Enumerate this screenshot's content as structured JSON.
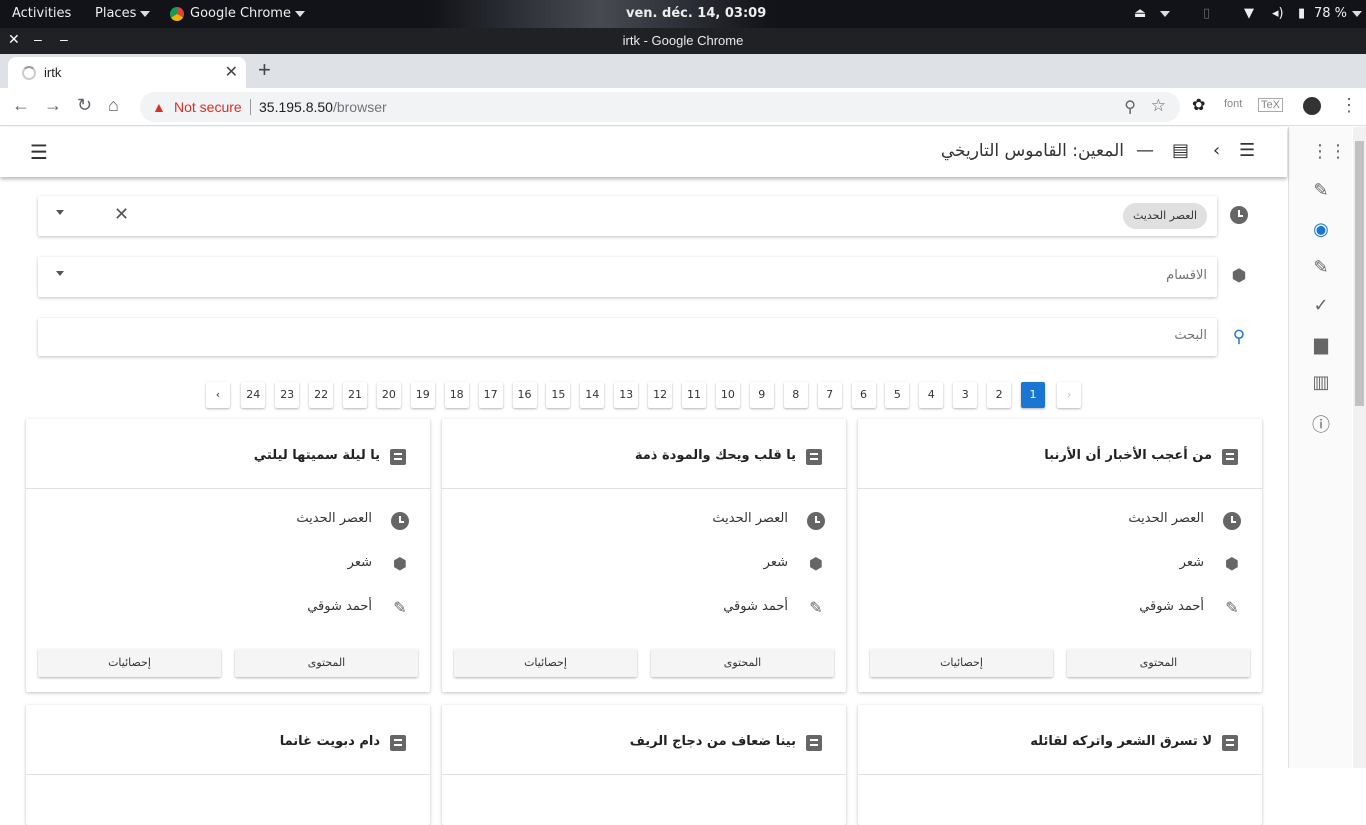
{
  "gnome": {
    "activities": "Activities",
    "places": "Places",
    "app": "Google Chrome",
    "clock": "ven. déc. 14, 03:09",
    "battery": "78 %"
  },
  "window": {
    "title": "irtk - Google Chrome"
  },
  "tab": {
    "label": "irtk"
  },
  "omnibox": {
    "security": "Not secure",
    "host": "35.195.8.50",
    "path": "/browser"
  },
  "extensions": {
    "font": "font"
  },
  "appbar": {
    "title": "المعين: القاموس التاريخي"
  },
  "filters": {
    "era_chip": "العصر الحديث",
    "sections_placeholder": "الاقسام",
    "search_placeholder": "البحث"
  },
  "pagination": {
    "active": "1",
    "pages": [
      "1",
      "2",
      "3",
      "4",
      "5",
      "6",
      "7",
      "8",
      "9",
      "10",
      "11",
      "12",
      "13",
      "14",
      "15",
      "16",
      "17",
      "18",
      "19",
      "20",
      "21",
      "22",
      "23",
      "24"
    ]
  },
  "cards": [
    {
      "title": "من أعجب الأخبار أن الأرنبا",
      "era": "العصر الحديث",
      "genre": "شعر",
      "author": "أحمد شوقي",
      "content_btn": "المحتوى",
      "stats_btn": "إحصائيات"
    },
    {
      "title": "يا قلب ويحك والمودة ذمة",
      "era": "العصر الحديث",
      "genre": "شعر",
      "author": "أحمد شوقي",
      "content_btn": "المحتوى",
      "stats_btn": "إحصائيات"
    },
    {
      "title": "يا ليلة سميتها ليلتي",
      "era": "العصر الحديث",
      "genre": "شعر",
      "author": "أحمد شوقي",
      "content_btn": "المحتوى",
      "stats_btn": "إحصائيات"
    },
    {
      "title": "لا تسرق الشعر واتركه لقائله"
    },
    {
      "title": "بينا ضعاف من دجاج الريف"
    },
    {
      "title": "دام دبويت غانما"
    }
  ]
}
